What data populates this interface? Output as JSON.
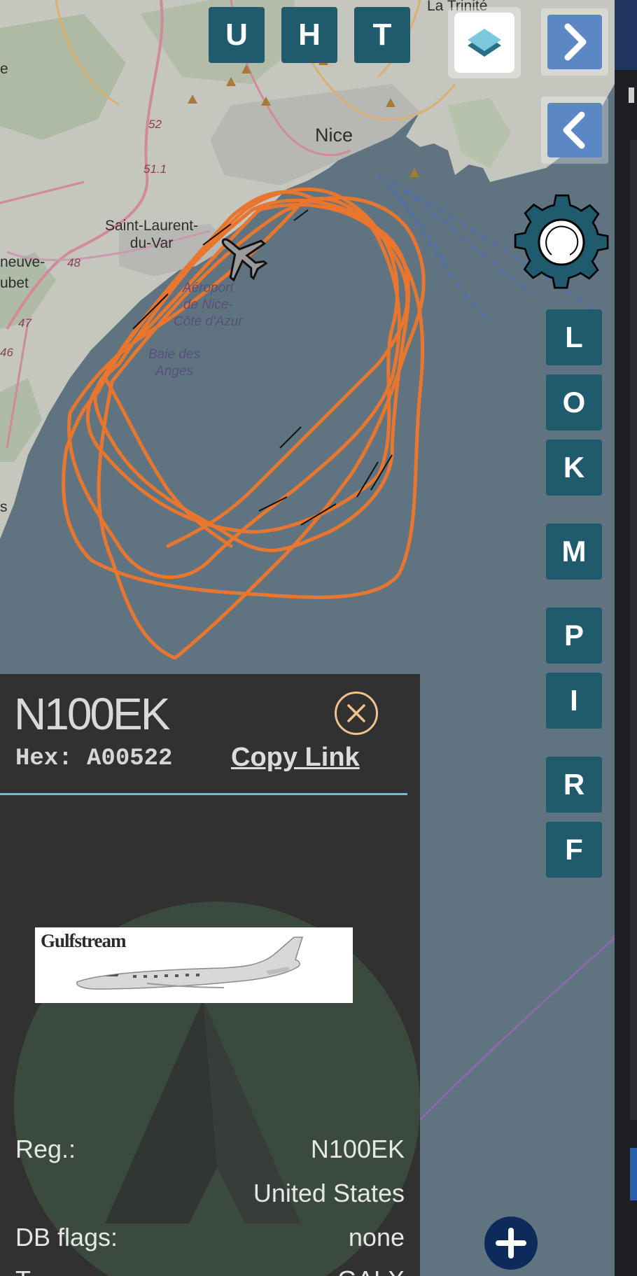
{
  "map": {
    "labels": {
      "nice": "Nice",
      "la_trinite": "La Trinité",
      "saint_laurent": "Saint-Laurent-\ndu-Var",
      "airport": "Aéroport\nde Nice-\nCôte d'Azur",
      "bay": "Baie des\nAnges",
      "villeneuve": "neuve-",
      "loubet": "ubet",
      "road_52": "52",
      "road_51_1": "51.1",
      "road_48": "48",
      "road_47": "47",
      "road_46": "46",
      "edge_e": "e",
      "edge_s": "s"
    }
  },
  "controls": {
    "top_buttons": [
      "U",
      "H",
      "T"
    ],
    "layers_icon": "layers-icon",
    "arrow_right_icon": "chevron-right-icon",
    "arrow_left_icon": "chevron-left-icon",
    "settings_icon": "gear-icon",
    "side_buttons": [
      "L",
      "O",
      "K",
      "M",
      "P",
      "I",
      "R",
      "F"
    ],
    "zoom_in_icon": "plus-icon"
  },
  "colors": {
    "track": "#e8762e",
    "button_bg": "#1f5a6d",
    "arrow_bg": "#5b87c4",
    "panel_bg": "#313131",
    "divider": "#7dbad0",
    "close_ring": "#f0c38a"
  },
  "panel": {
    "registration_title": "N100EK",
    "hex_label": "Hex: A00522",
    "copy_link": "Copy Link",
    "photo_brand": "Gulfstream",
    "rows": [
      {
        "label": "Reg.:",
        "value": "N100EK"
      },
      {
        "label": "",
        "value": "United States"
      },
      {
        "label": "DB flags:",
        "value": "none"
      },
      {
        "label": "T",
        "value": "GALX"
      }
    ]
  }
}
